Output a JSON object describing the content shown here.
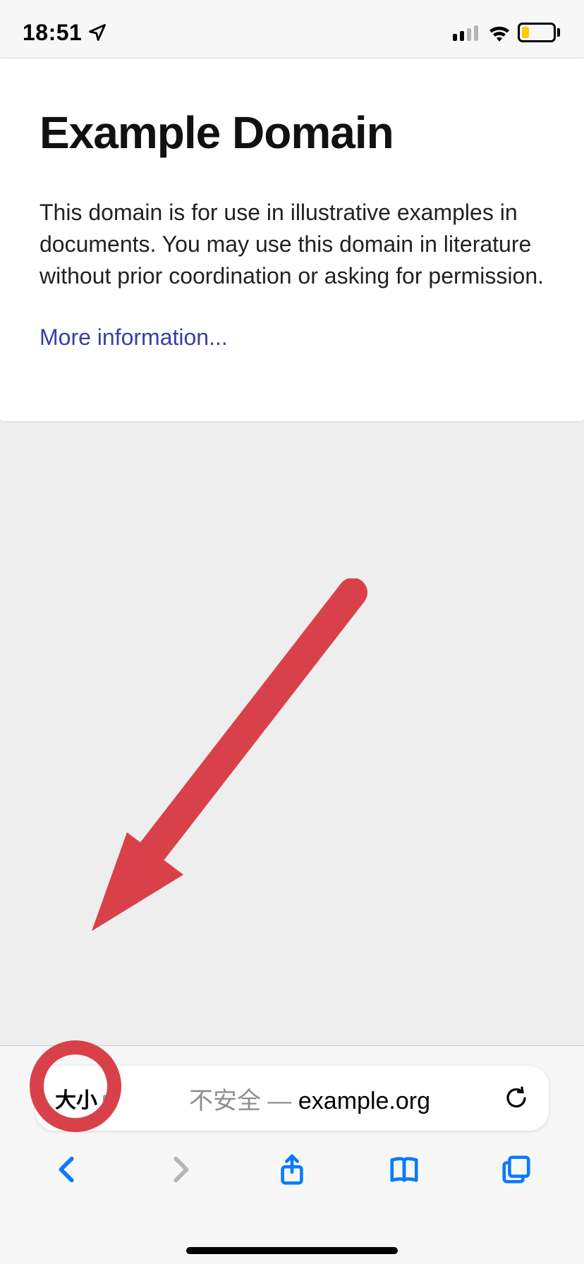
{
  "statusbar": {
    "time": "18:51"
  },
  "content": {
    "title": "Example Domain",
    "body": "This domain is for use in illustrative examples in documents. You may use this domain in literature without prior coordination or asking for permission.",
    "link_label": "More information..."
  },
  "urlbar": {
    "aa_label": "大小",
    "security_label": "不安全",
    "dash": " — ",
    "domain": "example.org"
  }
}
